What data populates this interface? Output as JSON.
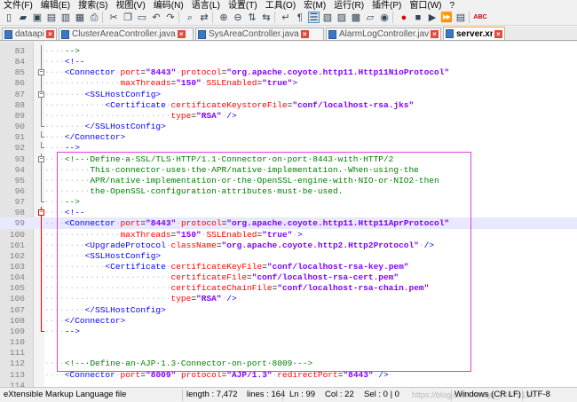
{
  "menu": [
    "文件(F)",
    "编辑(E)",
    "搜索(S)",
    "视图(V)",
    "编码(N)",
    "语言(L)",
    "设置(T)",
    "工具(O)",
    "宏(M)",
    "运行(R)",
    "插件(P)",
    "窗口(W)",
    "?"
  ],
  "tabs": [
    {
      "label": "dataapi.log"
    },
    {
      "label": "ClusterAreaController.java"
    },
    {
      "label": "SysAreaController.java"
    },
    {
      "label": "AlarmLogController.java"
    },
    {
      "label": "server.xml"
    }
  ],
  "status": {
    "file_type": "eXtensible Markup Language file",
    "length": "length : 7,472",
    "lines": "lines : 164",
    "ln": "Ln : 99",
    "col": "Col : 22",
    "sel": "Sel : 0 | 0",
    "eol": "Windows (CR LF)",
    "encoding": "UTF-8",
    "watermark": "https://blog.csdn.net/qq_24674131"
  },
  "lines": [
    {
      "n": "83",
      "fold": "line",
      "tokens": [
        [
          "ws",
          "····"
        ],
        [
          "cmt",
          "-->"
        ]
      ]
    },
    {
      "n": "84",
      "fold": "line",
      "tokens": [
        [
          "ws",
          "····"
        ],
        [
          "tag",
          "<!--"
        ]
      ]
    },
    {
      "n": "85",
      "fold": "box",
      "tokens": [
        [
          "ws",
          "····"
        ],
        [
          "tag",
          "<Connector"
        ],
        [
          "ws",
          "·"
        ],
        [
          "attr",
          "port"
        ],
        [
          "txt",
          "="
        ],
        [
          "val",
          "\"8443\""
        ],
        [
          "ws",
          "·"
        ],
        [
          "attr",
          "protocol"
        ],
        [
          "txt",
          "="
        ],
        [
          "val",
          "\"org.apache.coyote.http11.Http11NioProtocol\""
        ]
      ]
    },
    {
      "n": "86",
      "fold": "line",
      "tokens": [
        [
          "ws",
          "···············"
        ],
        [
          "attr",
          "maxThreads"
        ],
        [
          "txt",
          "="
        ],
        [
          "val",
          "\"150\""
        ],
        [
          "ws",
          "·"
        ],
        [
          "attr",
          "SSLEnabled"
        ],
        [
          "txt",
          "="
        ],
        [
          "val",
          "\"true\""
        ],
        [
          "tag",
          ">"
        ]
      ]
    },
    {
      "n": "87",
      "fold": "box",
      "tokens": [
        [
          "ws",
          "········"
        ],
        [
          "tag",
          "<SSLHostConfig>"
        ]
      ]
    },
    {
      "n": "88",
      "fold": "line",
      "tokens": [
        [
          "ws",
          "············"
        ],
        [
          "tag",
          "<Certificate"
        ],
        [
          "ws",
          "·"
        ],
        [
          "attr",
          "certificateKeystoreFile"
        ],
        [
          "txt",
          "="
        ],
        [
          "val",
          "\"conf/localhost-rsa.jks\""
        ]
      ]
    },
    {
      "n": "89",
      "fold": "line",
      "tokens": [
        [
          "ws",
          "·························"
        ],
        [
          "attr",
          "type"
        ],
        [
          "txt",
          "="
        ],
        [
          "val",
          "\"RSA\""
        ],
        [
          "ws",
          "·"
        ],
        [
          "tag",
          "/>"
        ]
      ]
    },
    {
      "n": "90",
      "fold": "end",
      "tokens": [
        [
          "ws",
          "········"
        ],
        [
          "tag",
          "</SSLHostConfig>"
        ]
      ]
    },
    {
      "n": "91",
      "fold": "end",
      "tokens": [
        [
          "ws",
          "····"
        ],
        [
          "tag",
          "</Connector>"
        ]
      ]
    },
    {
      "n": "92",
      "fold": "end",
      "tokens": [
        [
          "ws",
          "····"
        ],
        [
          "tag",
          "-->"
        ]
      ]
    },
    {
      "n": "93",
      "fold": "box",
      "tokens": [
        [
          "ws",
          "····"
        ],
        [
          "cmt",
          "<!--·Define·a·SSL/TLS·HTTP/1.1·Connector·on·port·8443·with·HTTP/2"
        ]
      ]
    },
    {
      "n": "94",
      "fold": "line",
      "tokens": [
        [
          "ws",
          "·········"
        ],
        [
          "cmt",
          "This·connector·uses·the·APR/native·implementation.·When·using·the"
        ]
      ]
    },
    {
      "n": "95",
      "fold": "line",
      "tokens": [
        [
          "ws",
          "·········"
        ],
        [
          "cmt",
          "APR/native·implementation·or·the·OpenSSL·engine·with·NIO·or·NIO2·then"
        ]
      ]
    },
    {
      "n": "96",
      "fold": "line",
      "tokens": [
        [
          "ws",
          "·········"
        ],
        [
          "cmt",
          "the·OpenSSL·configuration·attributes·must·be·used."
        ]
      ]
    },
    {
      "n": "97",
      "fold": "end",
      "tokens": [
        [
          "ws",
          "····"
        ],
        [
          "cmt",
          "-->"
        ]
      ]
    },
    {
      "n": "98",
      "fold": "redbox",
      "tokens": [
        [
          "ws",
          "····"
        ],
        [
          "tag",
          "<!--"
        ]
      ]
    },
    {
      "n": "99",
      "fold": "redline",
      "cur": true,
      "tokens": [
        [
          "ws",
          "····"
        ],
        [
          "tag",
          "<Connector"
        ],
        [
          "ws",
          "·"
        ],
        [
          "attr",
          "port"
        ],
        [
          "txt",
          "="
        ],
        [
          "val",
          "\"8443\""
        ],
        [
          "ws",
          "·"
        ],
        [
          "attr",
          "protocol"
        ],
        [
          "txt",
          "="
        ],
        [
          "val",
          "\"org.apache.coyote.http11.Http11AprProtocol\""
        ]
      ]
    },
    {
      "n": "100",
      "fold": "redline",
      "tokens": [
        [
          "ws",
          "···············"
        ],
        [
          "attr",
          "maxThreads"
        ],
        [
          "txt",
          "="
        ],
        [
          "val",
          "\"150\""
        ],
        [
          "ws",
          "·"
        ],
        [
          "attr",
          "SSLEnabled"
        ],
        [
          "txt",
          "="
        ],
        [
          "val",
          "\"true\""
        ],
        [
          "ws",
          "·"
        ],
        [
          "tag",
          ">"
        ]
      ]
    },
    {
      "n": "101",
      "fold": "redline",
      "tokens": [
        [
          "ws",
          "········"
        ],
        [
          "tag",
          "<UpgradeProtocol"
        ],
        [
          "ws",
          "·"
        ],
        [
          "attr",
          "className"
        ],
        [
          "txt",
          "="
        ],
        [
          "val",
          "\"org.apache.coyote.http2.Http2Protocol\""
        ],
        [
          "ws",
          "·"
        ],
        [
          "tag",
          "/>"
        ]
      ]
    },
    {
      "n": "102",
      "fold": "redline",
      "tokens": [
        [
          "ws",
          "········"
        ],
        [
          "tag",
          "<SSLHostConfig>"
        ]
      ]
    },
    {
      "n": "103",
      "fold": "redline",
      "tokens": [
        [
          "ws",
          "············"
        ],
        [
          "tag",
          "<Certificate"
        ],
        [
          "ws",
          "·"
        ],
        [
          "attr",
          "certificateKeyFile"
        ],
        [
          "txt",
          "="
        ],
        [
          "val",
          "\"conf/localhost-rsa-key.pem\""
        ]
      ]
    },
    {
      "n": "104",
      "fold": "redline",
      "tokens": [
        [
          "ws",
          "·························"
        ],
        [
          "attr",
          "certificateFile"
        ],
        [
          "txt",
          "="
        ],
        [
          "val",
          "\"conf/localhost-rsa-cert.pem\""
        ]
      ]
    },
    {
      "n": "105",
      "fold": "redline",
      "tokens": [
        [
          "ws",
          "·························"
        ],
        [
          "attr",
          "certificateChainFile"
        ],
        [
          "txt",
          "="
        ],
        [
          "val",
          "\"conf/localhost-rsa-chain.pem\""
        ]
      ]
    },
    {
      "n": "106",
      "fold": "redline",
      "tokens": [
        [
          "ws",
          "·························"
        ],
        [
          "attr",
          "type"
        ],
        [
          "txt",
          "="
        ],
        [
          "val",
          "\"RSA\""
        ],
        [
          "ws",
          "·"
        ],
        [
          "tag",
          "/>"
        ]
      ]
    },
    {
      "n": "107",
      "fold": "redline",
      "tokens": [
        [
          "ws",
          "········"
        ],
        [
          "tag",
          "</SSLHostConfig>"
        ]
      ]
    },
    {
      "n": "108",
      "fold": "redline",
      "tokens": [
        [
          "ws",
          "····"
        ],
        [
          "tag",
          "</Connector>"
        ]
      ]
    },
    {
      "n": "109",
      "fold": "redend",
      "tokens": [
        [
          "ws",
          "····"
        ],
        [
          "tag",
          "-->"
        ]
      ]
    },
    {
      "n": "110",
      "fold": "",
      "tokens": []
    },
    {
      "n": "111",
      "fold": "",
      "tokens": []
    },
    {
      "n": "112",
      "fold": "",
      "tokens": [
        [
          "ws",
          "····"
        ],
        [
          "cmt",
          "<!--·Define·an·AJP·1.3·Connector·on·port·8009·-->"
        ]
      ]
    },
    {
      "n": "113",
      "fold": "",
      "tokens": [
        [
          "ws",
          "····"
        ],
        [
          "tag",
          "<Connector"
        ],
        [
          "ws",
          "·"
        ],
        [
          "attr",
          "port"
        ],
        [
          "txt",
          "="
        ],
        [
          "val",
          "\"8009\""
        ],
        [
          "ws",
          "·"
        ],
        [
          "attr",
          "protocol"
        ],
        [
          "txt",
          "="
        ],
        [
          "val",
          "\"AJP/1.3\""
        ],
        [
          "ws",
          "·"
        ],
        [
          "attr",
          "redirectPort"
        ],
        [
          "txt",
          "="
        ],
        [
          "val",
          "\"8443\""
        ],
        [
          "ws",
          "·"
        ],
        [
          "tag",
          "/>"
        ]
      ]
    },
    {
      "n": "114",
      "fold": "",
      "tokens": []
    },
    {
      "n": "115",
      "fold": "",
      "tokens": []
    }
  ]
}
